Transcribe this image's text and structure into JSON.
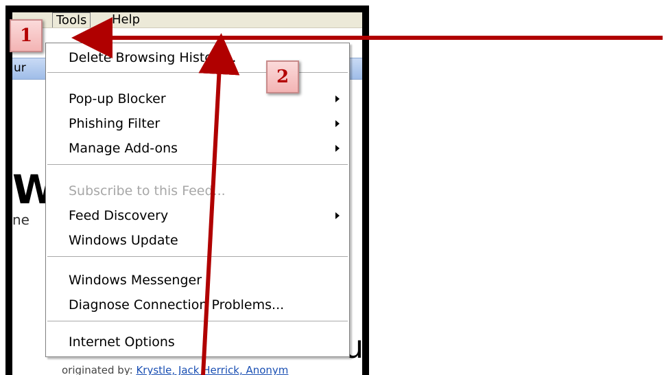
{
  "menubar": {
    "tools_label": "Tools",
    "help_label": "Help"
  },
  "tools_menu": {
    "items": [
      {
        "label": "Delete Browsing History...",
        "submenu": false,
        "enabled": true
      },
      {
        "label": "Pop-up Blocker",
        "submenu": true,
        "enabled": true
      },
      {
        "label": "Phishing Filter",
        "submenu": true,
        "enabled": true
      },
      {
        "label": "Manage Add-ons",
        "submenu": true,
        "enabled": true
      },
      {
        "label": "Subscribe to this Feed...",
        "submenu": false,
        "enabled": false
      },
      {
        "label": "Feed Discovery",
        "submenu": true,
        "enabled": true
      },
      {
        "label": "Windows Update",
        "submenu": false,
        "enabled": true
      },
      {
        "label": "Windows Messenger",
        "submenu": false,
        "enabled": true
      },
      {
        "label": "Diagnose Connection Problems...",
        "submenu": false,
        "enabled": true
      },
      {
        "label": "Internet Options",
        "submenu": false,
        "enabled": true
      }
    ]
  },
  "background": {
    "fragment_ur": "ur",
    "fragment_logo": "W",
    "fragment_he": "ne",
    "fragment_u": "u",
    "credits_prefix": "originated by: ",
    "credits_links": "Krystle, Jack Herrick, Anonym"
  },
  "callouts": {
    "step1": "1",
    "step2": "2"
  },
  "colors": {
    "arrow": "#b00000",
    "callout_text": "#b30000",
    "menu_disabled": "#a7a7a7"
  }
}
